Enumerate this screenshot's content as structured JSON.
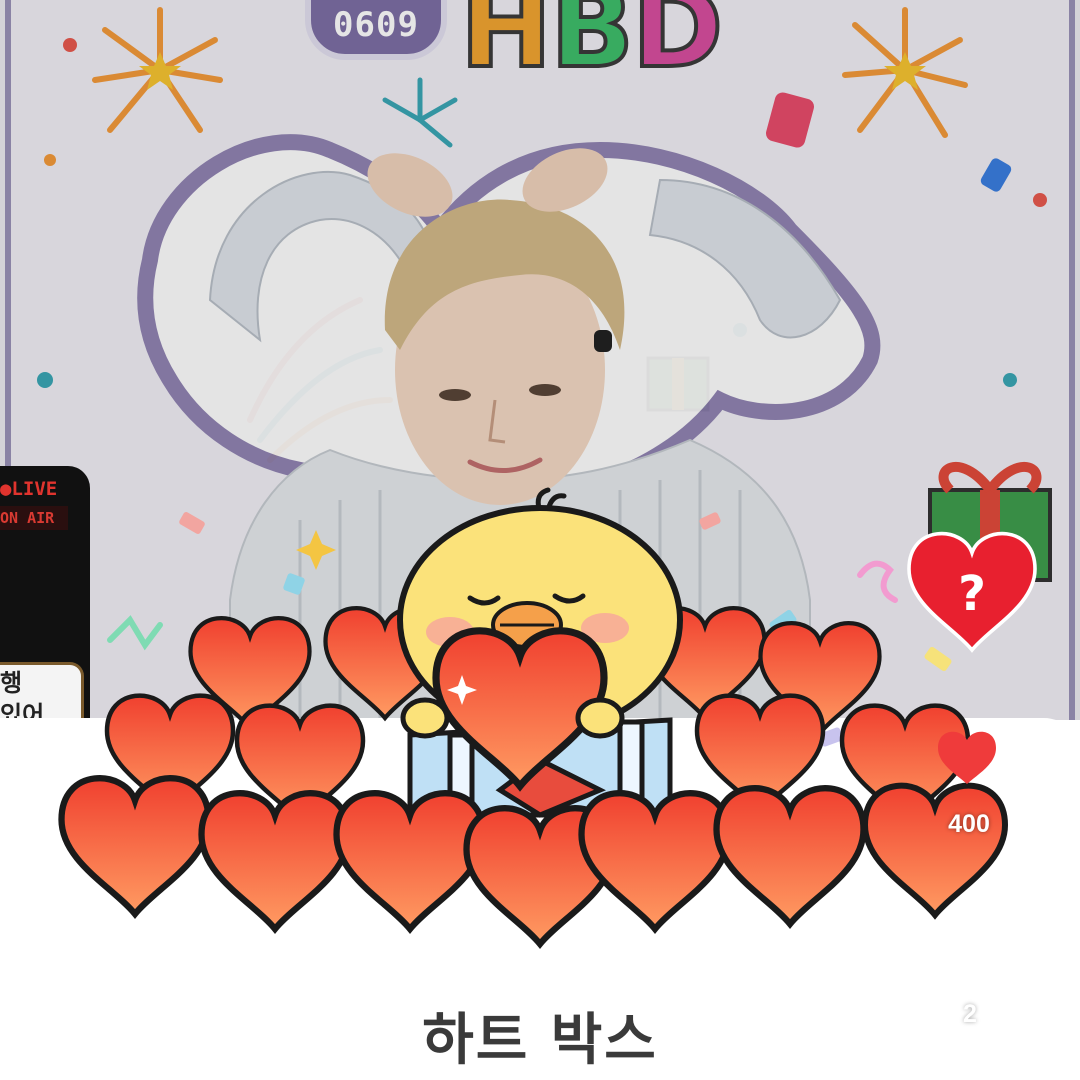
{
  "banner": {
    "date_badge": "0609",
    "title_letters": [
      "H",
      "B",
      "D"
    ],
    "title_colors": [
      "#f2a531",
      "#3fbf6b",
      "#d94fa0"
    ]
  },
  "live_panel": {
    "live_label": "●LIVE",
    "on_air_label": "ON AIR",
    "message_lines": [
      "행",
      "있어."
    ]
  },
  "item": {
    "title": "하트 박스",
    "heart_count": "400",
    "like_count": "2",
    "mystery_icon": "question-heart-icon"
  },
  "colors": {
    "heart_fill": "#f25a3c",
    "heart_outline": "#1a1a1a",
    "chick": "#fbe27a",
    "modal_bg": "#ffffff",
    "mystery_heart": "#e8202f"
  }
}
